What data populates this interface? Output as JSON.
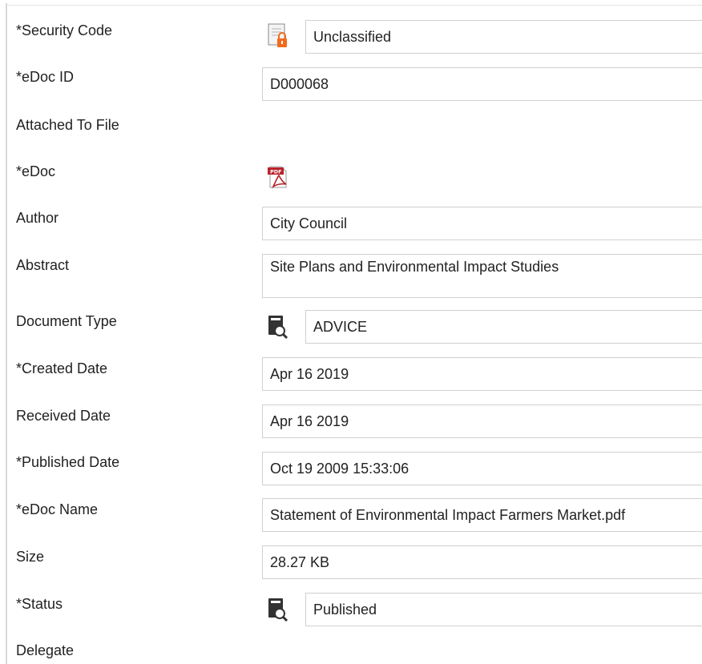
{
  "form": {
    "security_code": {
      "label": "*Security Code",
      "value": "Unclassified",
      "icon": "lock-icon"
    },
    "edoc_id": {
      "label": "*eDoc ID",
      "value": "D000068"
    },
    "attached_to_file": {
      "label": "Attached To File"
    },
    "edoc": {
      "label": "*eDoc",
      "icon": "pdf-icon",
      "icon_text": "PDF"
    },
    "author": {
      "label": "Author",
      "value": "City Council"
    },
    "abstract": {
      "label": "Abstract",
      "value": "Site Plans and Environmental Impact Studies"
    },
    "document_type": {
      "label": "Document Type",
      "value": "ADVICE",
      "icon": "document-search-icon"
    },
    "created_date": {
      "label": "*Created Date",
      "value": "Apr 16 2019"
    },
    "received_date": {
      "label": "Received Date",
      "value": "Apr 16 2019"
    },
    "published_date": {
      "label": "*Published Date",
      "value": "Oct 19 2009 15:33:06"
    },
    "edoc_name": {
      "label": "*eDoc Name",
      "value": "Statement of Environmental Impact Farmers Market.pdf"
    },
    "size": {
      "label": "Size",
      "value": "28.27 KB"
    },
    "status": {
      "label": "*Status",
      "value": "Published",
      "icon": "document-search-icon"
    },
    "delegate": {
      "label": "Delegate"
    }
  },
  "colors": {
    "lock": "#f26a1b",
    "pdf": "#b8232a",
    "lookup": "#333333",
    "border": "#d0d0d0"
  }
}
